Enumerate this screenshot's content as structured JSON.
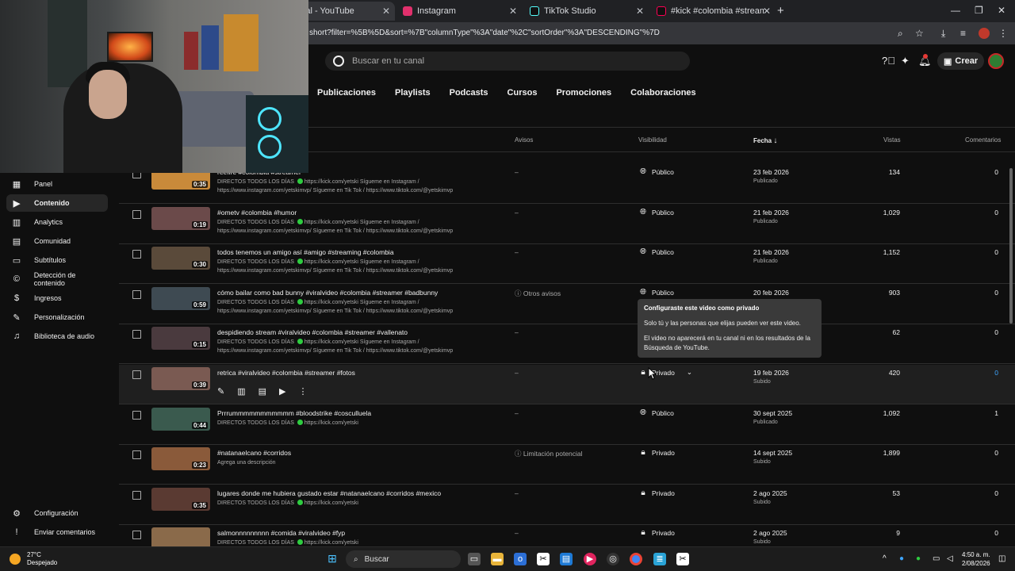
{
  "browser": {
    "tabs": [
      {
        "label": "nido del canal - YouTube",
        "fav_color": "#ff0000"
      },
      {
        "label": "Instagram",
        "fav_color": "#e1306c"
      },
      {
        "label": "TikTok Studio",
        "fav_color": "#111111"
      },
      {
        "label": "#kick #colombia #streamer #ye",
        "fav_color": "#ff0050"
      }
    ],
    "url": "short?filter=%5B%5D&sort=%7B\"columnType\"%3A\"date\"%2C\"sortOrder\"%3A\"DESCENDING\"%7D"
  },
  "header": {
    "search_placeholder": "Buscar en tu canal",
    "create_label": "Crear"
  },
  "category_tabs": [
    "Publicaciones",
    "Playlists",
    "Podcasts",
    "Cursos",
    "Promociones",
    "Colaboraciones"
  ],
  "columns": {
    "notices": "Avisos",
    "visibility": "Visibilidad",
    "date": "Fecha",
    "views": "Vistas",
    "comments": "Comentarios"
  },
  "sidebar": {
    "items": [
      {
        "label": "Panel",
        "icon": "grid-icon",
        "glyph": "▦"
      },
      {
        "label": "Contenido",
        "icon": "content-icon",
        "glyph": "▶"
      },
      {
        "label": "Analytics",
        "icon": "analytics-icon",
        "glyph": "▥"
      },
      {
        "label": "Comunidad",
        "icon": "community-icon",
        "glyph": "▤"
      },
      {
        "label": "Subtítulos",
        "icon": "subtitles-icon",
        "glyph": "▭"
      },
      {
        "label": "Detección de contenido",
        "icon": "copyright-icon",
        "glyph": "©"
      },
      {
        "label": "Ingresos",
        "icon": "earn-icon",
        "glyph": "$"
      },
      {
        "label": "Personalización",
        "icon": "customization-icon",
        "glyph": "✎"
      },
      {
        "label": "Biblioteca de audio",
        "icon": "audio-library-icon",
        "glyph": "♫"
      }
    ],
    "bottom": [
      {
        "label": "Configuración",
        "icon": "gear-icon",
        "glyph": "⚙"
      },
      {
        "label": "Enviar comentarios",
        "icon": "feedback-icon",
        "glyph": "!"
      }
    ]
  },
  "rows": [
    {
      "title": "reefire #colombia #streamer",
      "desc1": "DIRECTOS TODOS LOS DÍAS",
      "desc1b": "https://kick.com/yetski Sígueme en Instagram /",
      "desc2": "https://www.instagram.com/yetskimvp/ Sígueme en Tik Tok / https://www.tiktok.com/@yetskimvp",
      "duration": "0:35",
      "notice": "–",
      "visibility": "Público",
      "vis_icon": "globe-icon",
      "date": "23 feb 2026",
      "status": "Publicado",
      "views": "134",
      "comments": "0",
      "thumb": "#c98a3a"
    },
    {
      "title": "#ometv #colombia #humor",
      "desc1": "DIRECTOS TODOS LOS DÍAS",
      "desc1b": "https://kick.com/yetski Sígueme en Instagram /",
      "desc2": "https://www.instagram.com/yetskimvp/ Sígueme en Tik Tok / https://www.tiktok.com/@yetskimvp",
      "duration": "0:19",
      "notice": "–",
      "visibility": "Público",
      "vis_icon": "globe-icon",
      "date": "21 feb 2026",
      "status": "Publicado",
      "views": "1,029",
      "comments": "0",
      "thumb": "#6b4a4a"
    },
    {
      "title": "todos tenemos un amigo así #amigo #streaming #colombia",
      "desc1": "DIRECTOS TODOS LOS DÍAS",
      "desc1b": "https://kick.com/yetski Sígueme en Instagram /",
      "desc2": "https://www.instagram.com/yetskimvp/ Sígueme en Tik Tok / https://www.tiktok.com/@yetskimvp",
      "duration": "0:30",
      "notice": "–",
      "visibility": "Público",
      "vis_icon": "globe-icon",
      "date": "21 feb 2026",
      "status": "Publicado",
      "views": "1,152",
      "comments": "0",
      "thumb": "#5a4a3a"
    },
    {
      "title": "cómo bailar como bad bunny #viralvideo #colombia #streamer #badbunny",
      "desc1": "DIRECTOS TODOS LOS DÍAS",
      "desc1b": "https://kick.com/yetski Sígueme en Instagram /",
      "desc2": "https://www.instagram.com/yetskimvp/ Sígueme en Tik Tok / https://www.tiktok.com/@yetskimvp",
      "duration": "0:59",
      "notice": "Otros avisos",
      "visibility": "Público",
      "vis_icon": "globe-icon",
      "date": "20 feb 2026",
      "status": "",
      "views": "903",
      "comments": "0",
      "thumb": "#3e4a52"
    },
    {
      "title": "despidiendo stream #viralvideo #colombia #streamer #vallenato",
      "desc1": "DIRECTOS TODOS LOS DÍAS",
      "desc1b": "https://kick.com/yetski Sígueme en Instagram /",
      "desc2": "https://www.instagram.com/yetskimvp/ Sígueme en Tik Tok / https://www.tiktok.com/@yetskimvp",
      "duration": "0:15",
      "notice": "–",
      "visibility": "",
      "vis_icon": "",
      "date": "",
      "status": "",
      "views": "62",
      "comments": "0",
      "thumb": "#4a3a3e"
    },
    {
      "title": "retrica #viralvideo #colombia #streamer #fotos",
      "desc1": "",
      "desc1b": "",
      "desc2": "",
      "duration": "0:39",
      "notice": "–",
      "visibility": "Privado",
      "vis_icon": "lock-icon",
      "date": "19 feb 2026",
      "status": "Subido",
      "views": "420",
      "comments": "0",
      "thumb": "#7a5a52",
      "hover": true
    },
    {
      "title": "Prrrummmmmmmmmmm #bloodstrike #cosculluela",
      "desc1": "DIRECTOS TODOS LOS DÍAS",
      "desc1b": "https://kick.com/yetski",
      "desc2": "",
      "duration": "0:44",
      "notice": "–",
      "visibility": "Público",
      "vis_icon": "globe-icon",
      "date": "30 sept 2025",
      "status": "Publicado",
      "views": "1,092",
      "comments": "1",
      "thumb": "#3a5a4e"
    },
    {
      "title": "#natanaelcano #corridos",
      "desc1": "Agrega una descripción",
      "desc1b": "",
      "desc2": "",
      "duration": "0:23",
      "notice": "Limitación potencial",
      "visibility": "Privado",
      "vis_icon": "lock-icon",
      "date": "14 sept 2025",
      "status": "Subido",
      "views": "1,899",
      "comments": "0",
      "thumb": "#8a5a3a"
    },
    {
      "title": "lugares donde me hubiera gustado estar #natanaelcano #corridos #mexico",
      "desc1": "DIRECTOS TODOS LOS DÍAS",
      "desc1b": "https://kick.com/yetski",
      "desc2": "",
      "duration": "0:35",
      "notice": "–",
      "visibility": "Privado",
      "vis_icon": "lock-icon",
      "date": "2 ago 2025",
      "status": "Subido",
      "views": "53",
      "comments": "0",
      "thumb": "#5a3a32"
    },
    {
      "title": "salmonnnnnnnnn #comida #viralvideo #fyp",
      "desc1": "DIRECTOS TODOS LOS DÍAS",
      "desc1b": "https://kick.com/yetski",
      "desc2": "",
      "duration": "",
      "notice": "–",
      "visibility": "Privado",
      "vis_icon": "lock-icon",
      "date": "2 ago 2025",
      "status": "Subido",
      "views": "9",
      "comments": "0",
      "thumb": "#8a6a4a"
    }
  ],
  "tooltip": {
    "title": "Configuraste este video como privado",
    "line1": "Solo tú y las personas que elijas pueden ver este video.",
    "line2": "El video no aparecerá en tu canal ni en los resultados de la Búsqueda de YouTube."
  },
  "taskbar": {
    "weather_temp": "27°C",
    "weather_desc": "Despejado",
    "search_label": "Buscar",
    "time": "4:50 a. m.",
    "date": "2/08/2026"
  },
  "colors": {
    "background": "#0f0f0f",
    "accent_blue": "#3ea6ff",
    "kick_green": "#2ecc40"
  }
}
